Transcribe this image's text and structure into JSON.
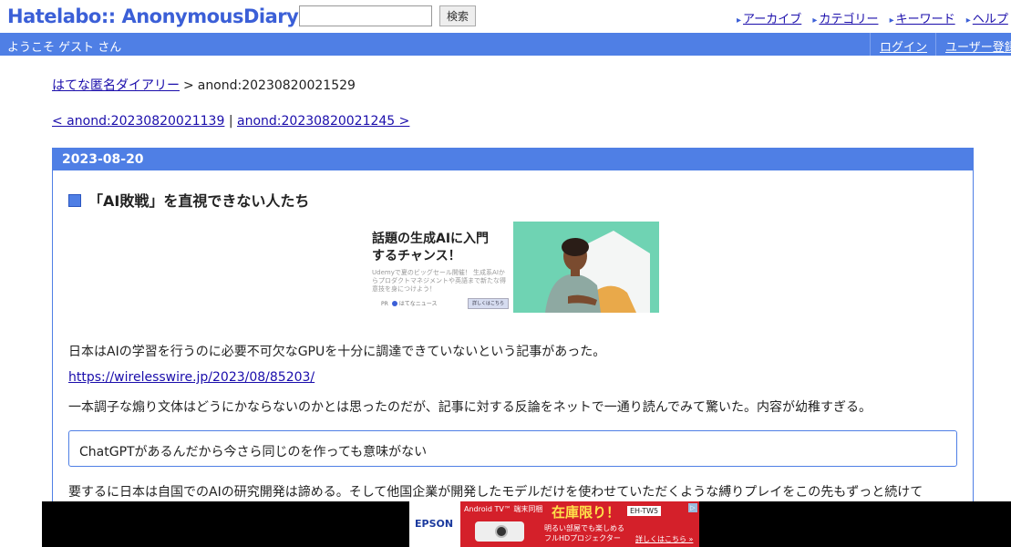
{
  "header": {
    "logo": "Hatelabo:: AnonymousDiary",
    "search": {
      "value": "",
      "button_label": "検索"
    },
    "nav": [
      {
        "label": "アーカイブ"
      },
      {
        "label": "カテゴリー"
      },
      {
        "label": "キーワード"
      },
      {
        "label": "ヘルプ"
      }
    ]
  },
  "userbar": {
    "welcome": "ようこそ ゲスト さん",
    "login": "ログイン",
    "register": "ユーザー登録"
  },
  "breadcrumb": {
    "home": "はてな匿名ダイアリー",
    "separator": ">",
    "current": "anond:20230820021529"
  },
  "pager": {
    "prev": "< anond:20230820021139",
    "divider": "|",
    "next": "anond:20230820021245 >"
  },
  "day": {
    "date": "2023-08-20",
    "entry": {
      "title": "「AI敗戦」を直視できない人たち",
      "paragraph1": "日本はAIの学習を行うのに必要不可欠なGPUを十分に調達できていないという記事があった。",
      "link": "https://wirelesswire.jp/2023/08/85203/",
      "paragraph2": "一本調子な煽り文体はどうにかならないのかとは思ったのだが、記事に対する反論をネットで一通り読んでみて驚いた。内容が幼稚すぎる。",
      "quote": "ChatGPTがあるんだから今さら同じのを作っても意味がない",
      "paragraph3": "要するに日本は自国でのAIの研究開発は諦める。そして他国企業が開発したモデルだけを使わせていただくような縛りプレイをこの先もずっと続けて"
    }
  },
  "ad_inline": {
    "headline_line1": "話題の生成AIに入門",
    "headline_line2": "するチャンス！",
    "sub": "Udemyで夏のビッグセール開催！ 生成系AIからプロダクトマネジメントや英語まで新たな得意技を身につけよう！",
    "footer": "はてなニュース",
    "footer_tag": "PR",
    "cta": "詳しくはこちら"
  },
  "ad_bottom": {
    "brand": "EPSON",
    "tag": "Android TV™ 端末同梱",
    "headline": "在庫限り！",
    "model": "EH-TW5",
    "line1": "明るい部屋でも楽しめる",
    "line2": "フルHDプロジェクター",
    "more": "詳しくはこちら »",
    "ad_marker": "▷"
  },
  "colors": {
    "accent": "#4f7fe5",
    "link": "#1a0dab",
    "ad_red": "#d4202a",
    "ad_photo_bg": "#6fd3b3"
  }
}
